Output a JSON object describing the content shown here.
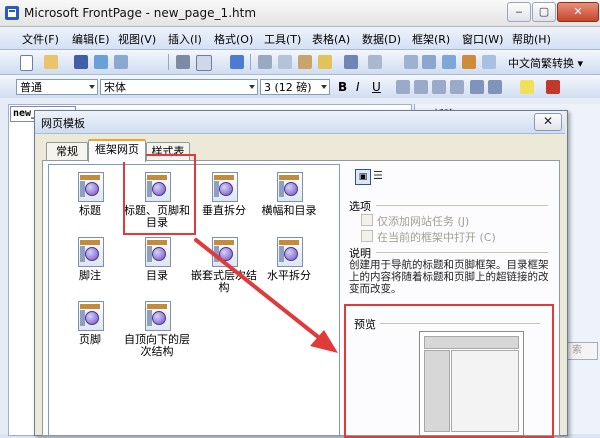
{
  "window": {
    "title": "Microsoft FrontPage - new_page_1.htm",
    "min": "‒",
    "max": "▢",
    "close": "✕"
  },
  "menu": [
    "文件(F)",
    "编辑(E)",
    "视图(V)",
    "插入(I)",
    "格式(O)",
    "工具(T)",
    "表格(A)",
    "数据(D)",
    "框架(R)",
    "窗口(W)",
    "帮助(H)"
  ],
  "toolbar": {
    "convert_label": "中文简繁转换 ▾"
  },
  "format_bar": {
    "style_value": "普通",
    "font_value": "宋体",
    "size_value": "3 (12 磅)",
    "bold": "B",
    "italic": "I",
    "underline": "U"
  },
  "workspace": {
    "doc_tab_label": "new_",
    "taskpane_title": "▪ 新建",
    "taskpane_search": "索"
  },
  "dialog": {
    "title": "网页模板",
    "close": "✕",
    "tabs": [
      "常规",
      "框架网页",
      "样式表"
    ],
    "templates": [
      {
        "label": "标题"
      },
      {
        "label": "标题、页脚和目录"
      },
      {
        "label": "垂直拆分"
      },
      {
        "label": "横幅和目录"
      },
      {
        "label": "脚注"
      },
      {
        "label": "目录"
      },
      {
        "label": "嵌套式层次结构"
      },
      {
        "label": "水平拆分"
      },
      {
        "label": "页脚"
      },
      {
        "label": "自顶向下的层次结构"
      }
    ],
    "options_label": "选项",
    "option_add_task": "仅添加网站任务 (J)",
    "option_open_current": "在当前的框架中打开 (C)",
    "description_label": "说明",
    "description_text": "创建用于导航的标题和页脚框架。目录框架上的内容将随着标题和页脚上的超链接的改变而改变。",
    "preview_label": "预览"
  },
  "colors": {
    "annotation": "#e03a3a",
    "accent_tab": "#f0a040"
  }
}
